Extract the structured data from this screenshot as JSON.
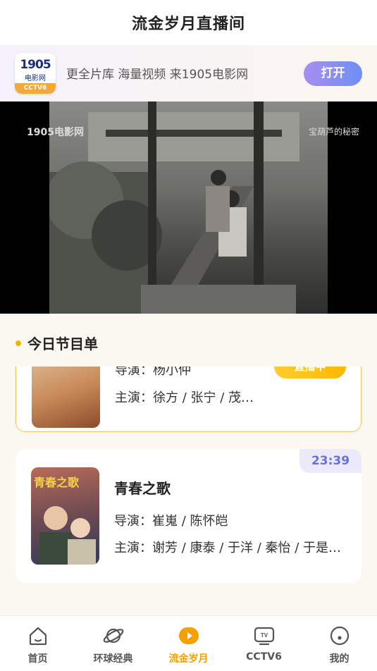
{
  "header": {
    "title": "流金岁月直播间"
  },
  "banner": {
    "logo": {
      "line1": "1905",
      "line2": "电影网",
      "badge": "CCTV6"
    },
    "text": "更全片库 海量视频 来1905电影网",
    "open_label": "打开"
  },
  "player": {
    "watermark_left": "1905电影网",
    "watermark_right": "宝葫芦的秘密"
  },
  "schedule": {
    "title": "今日节目单",
    "items": [
      {
        "director": "导演：杨小仲",
        "cast": "主演：徐方 / 张宁 / 茂…",
        "live_label": "直播中"
      },
      {
        "time": "23:39",
        "poster_text": "青春之歌",
        "title": "青春之歌",
        "director": "导演：崔嵬 / 陈怀皑",
        "cast": "主演：谢芳 / 康泰 / 于洋 / 秦怡 / 于是…"
      }
    ]
  },
  "tabbar": {
    "tabs": [
      {
        "label": "首页",
        "icon": "home-icon"
      },
      {
        "label": "环球经典",
        "icon": "planet-icon"
      },
      {
        "label": "流金岁月",
        "icon": "play-icon"
      },
      {
        "label": "CCTV6",
        "icon": "tv-icon"
      },
      {
        "label": "我的",
        "icon": "profile-icon"
      }
    ],
    "active_index": 2,
    "accent": "#f5a000"
  }
}
